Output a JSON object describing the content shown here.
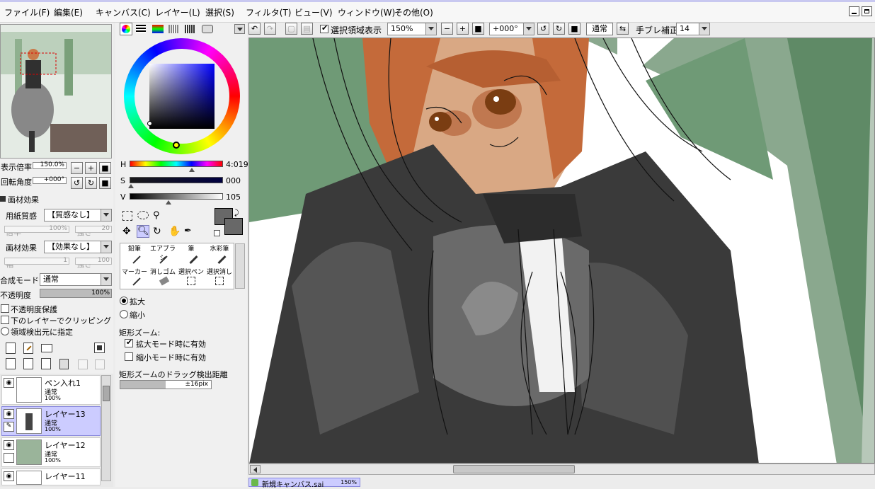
{
  "menu": [
    "ファイル(F)",
    "編集(E)",
    "キャンバス(C)",
    "レイヤー(L)",
    "選択(S)",
    "フィルタ(T)",
    "ビュー(V)",
    "ウィンドウ(W)",
    "その他(O)"
  ],
  "navigator": {
    "zoom_label": "表示倍率",
    "zoom_value": "150.0%",
    "rotate_label": "回転角度",
    "rotate_value": "+000°"
  },
  "brush_tex": {
    "section": "画材効果",
    "paper_label": "用紙質感",
    "paper_value": "【質感なし】",
    "scale_label": "倍率",
    "scale_value": "100%",
    "strength_label": "強さ",
    "strength_value": "20",
    "effect_label": "画材効果",
    "effect_value": "【効果なし】",
    "width_label": "幅",
    "width_value": "1",
    "strength2_label": "強さ",
    "strength2_value": "100"
  },
  "layer_props": {
    "blend_label": "合成モード",
    "blend_value": "通常",
    "opacity_label": "不透明度",
    "opacity_value": "100%",
    "protect_label": "不透明度保護",
    "clip_label": "下のレイヤーでクリッピング",
    "source_label": "領域検出元に指定"
  },
  "layers": [
    {
      "name": "ペン入れ1",
      "mode": "通常",
      "opacity": "100%"
    },
    {
      "name": "レイヤー13",
      "mode": "通常",
      "opacity": "100%"
    },
    {
      "name": "レイヤー12",
      "mode": "通常",
      "opacity": "100%"
    },
    {
      "name": "レイヤー11",
      "mode": "",
      "opacity": ""
    }
  ],
  "color": {
    "h_label": "H",
    "h_value": "4:019",
    "s_label": "S",
    "s_value": "000",
    "v_label": "V",
    "v_value": "105",
    "main_color": "#686868",
    "sub_color": "#686868"
  },
  "tools": [
    {
      "label": "鉛筆"
    },
    {
      "label": "エアブラシ"
    },
    {
      "label": "筆"
    },
    {
      "label": "水彩筆"
    },
    {
      "label": "マーカー"
    },
    {
      "label": "消しゴム"
    },
    {
      "label": "選択ペン"
    },
    {
      "label": "選択消し"
    }
  ],
  "zoom_tool": {
    "enlarge": "拡大",
    "shrink": "縮小",
    "rect_label": "矩形ズーム:",
    "rect_enlarge": "拡大モード時に有効",
    "rect_shrink": "縮小モード時に有効",
    "drag_label": "矩形ズームのドラッグ検出距離",
    "drag_value": "±16pix"
  },
  "toolbar": {
    "sel_area_label": "選択領域表示",
    "zoom": "150%",
    "angle": "+000°",
    "mode": "通常",
    "stab_label": "手ブレ補正",
    "stab_value": "14"
  },
  "status": {
    "tab_label": "新規キャンバス.sai",
    "tab_zoom": "150%"
  }
}
